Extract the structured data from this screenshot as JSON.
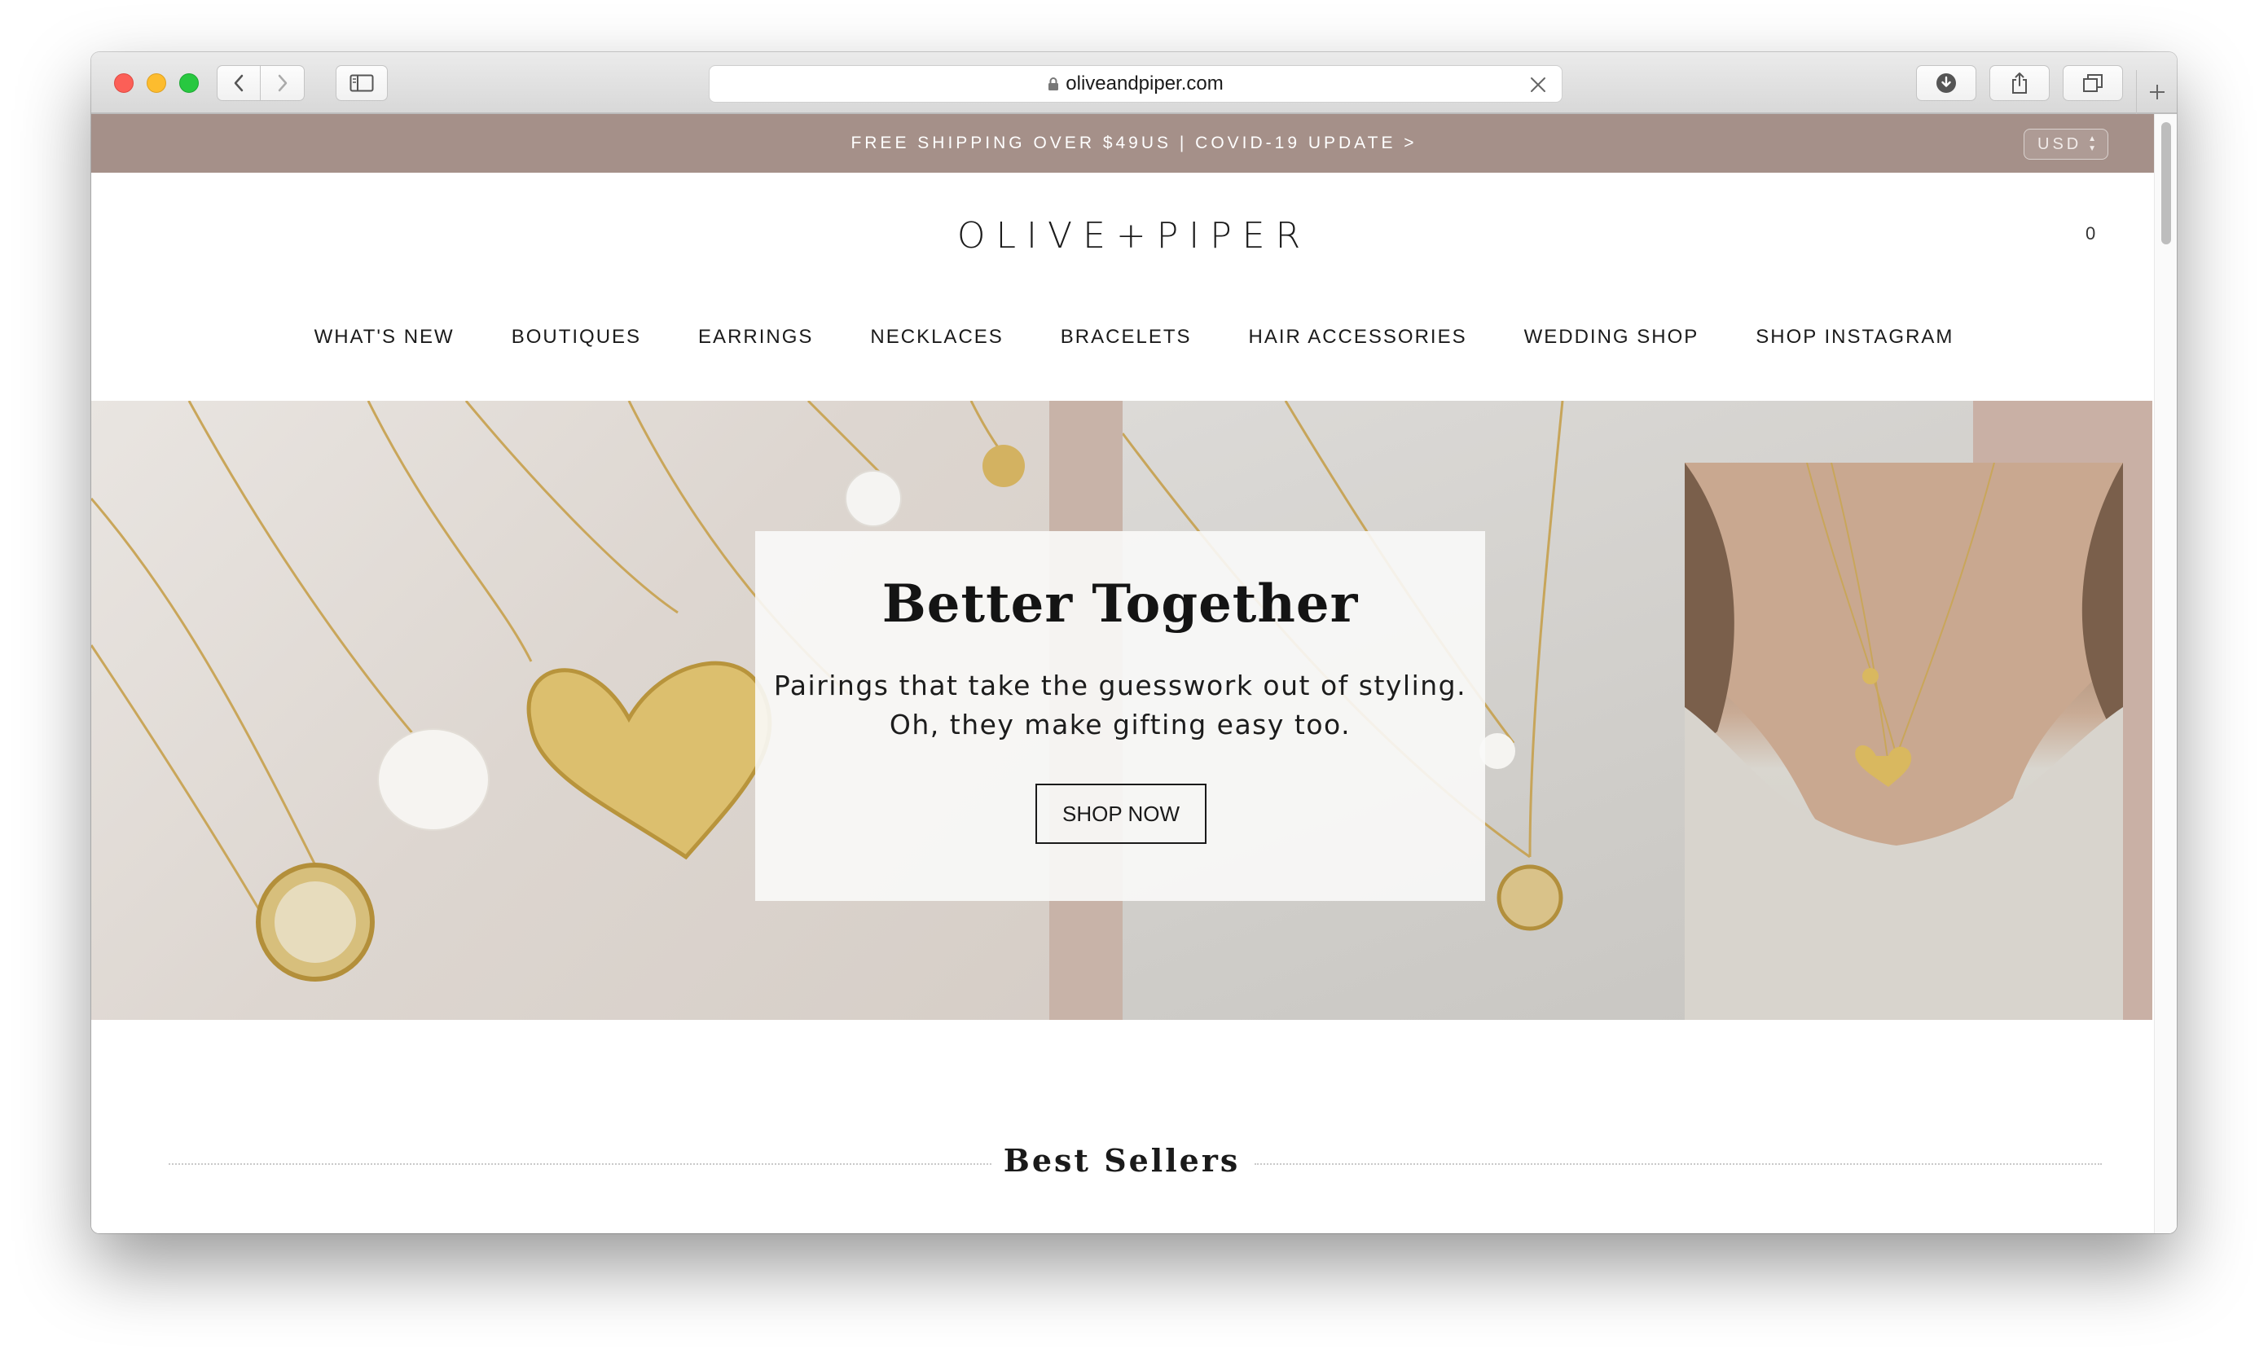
{
  "browser": {
    "url": "oliveandpiper.com"
  },
  "announcement": {
    "text": "FREE SHIPPING OVER $49US | COVID-19 UPDATE >",
    "currency": "USD"
  },
  "header": {
    "logo": "OLIVE+PIPER",
    "cart_count": "0"
  },
  "nav": {
    "items": [
      "WHAT'S NEW",
      "BOUTIQUES",
      "EARRINGS",
      "NECKLACES",
      "BRACELETS",
      "HAIR ACCESSORIES",
      "WEDDING SHOP",
      "SHOP INSTAGRAM"
    ]
  },
  "hero": {
    "title": "Better Together",
    "subtitle_line1": "Pairings that take the guesswork out of styling.",
    "subtitle_line2": "Oh, they make gifting easy too.",
    "button": "SHOP NOW"
  },
  "best_sellers": {
    "title": "Best Sellers"
  },
  "colors": {
    "announcement_bar": "#a59089",
    "text": "#1a1a1a",
    "accent_strip": "#c8b3a8"
  },
  "icons": [
    "back-arrow-icon",
    "forward-arrow-icon",
    "sidebar-icon",
    "lock-icon",
    "close-icon",
    "download-icon",
    "share-icon",
    "tabs-icon",
    "plus-icon"
  ]
}
